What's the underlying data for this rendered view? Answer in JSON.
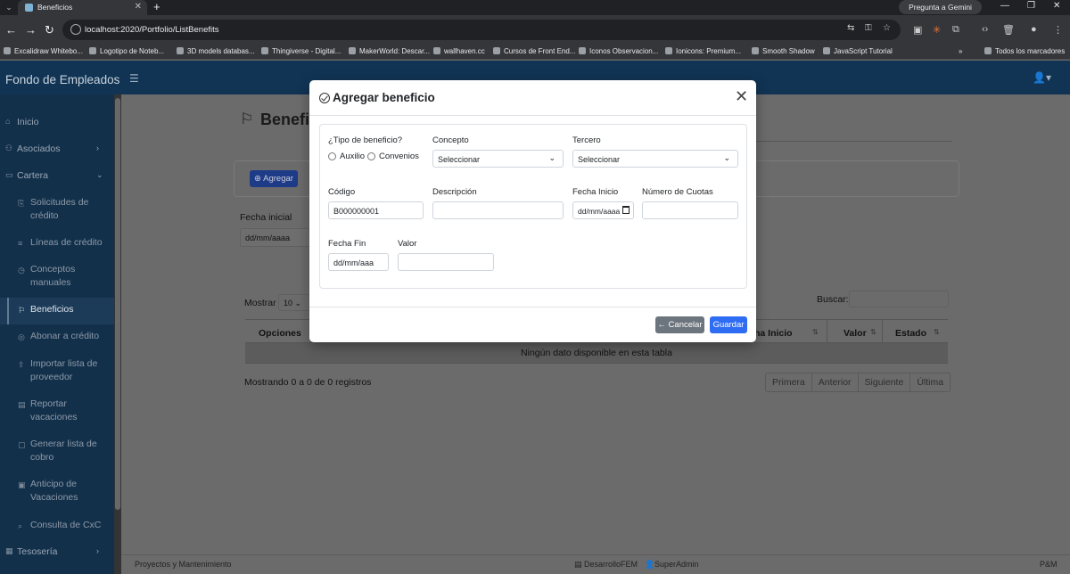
{
  "browser": {
    "tab_title": "Beneficios",
    "gemini_label": "Pregunta a Gemini",
    "url": "localhost:2020/Portfolio/ListBenefits",
    "bookmarks": [
      "Excalidraw Whitebo...",
      "Logotipo de Noteb...",
      "3D models databas...",
      "Thingiverse - Digital...",
      "MakerWorld: Descar...",
      "wallhaven.cc",
      "Cursos de Front End...",
      "Iconos Observacion...",
      "Ionicons: Premium...",
      "Smooth Shadow",
      "JavaScript Tutorial"
    ],
    "all_bookmarks": "Todos los marcadores"
  },
  "app": {
    "brand": "Fondo de Empleados"
  },
  "sidebar": {
    "items": [
      {
        "label": "Inicio",
        "icon": "home-icon"
      },
      {
        "label": "Asociados",
        "icon": "users-icon"
      },
      {
        "label": "Cartera",
        "icon": "wallet-icon"
      }
    ],
    "sub_items": [
      {
        "label": "Solicitudes de crédito",
        "icon": "request-icon"
      },
      {
        "label": "Líneas de crédito",
        "icon": "list-icon"
      },
      {
        "label": "Conceptos manuales",
        "icon": "concept-icon"
      },
      {
        "label": "Beneficios",
        "icon": "flag-icon"
      },
      {
        "label": "Abonar a crédito",
        "icon": "payment-icon"
      },
      {
        "label": "Importar lista de proveedor",
        "icon": "import-icon"
      },
      {
        "label": "Reportar vacaciones",
        "icon": "report-icon"
      },
      {
        "label": "Generar lista de cobro",
        "icon": "generate-icon"
      },
      {
        "label": "Anticipo de Vacaciones",
        "icon": "advance-icon"
      },
      {
        "label": "Consulta de CxC",
        "icon": "search-icon"
      }
    ],
    "bottom_item": {
      "label": "Tesosería",
      "icon": "treasury-icon"
    }
  },
  "page": {
    "title": "Beneficios",
    "add_button": "Agregar",
    "fecha_inicial_label": "Fecha inicial",
    "fecha_inicial_placeholder": "dd/mm/aaaa",
    "mostrar_label": "Mostrar",
    "mostrar_value": "10",
    "buscar_label": "Buscar:",
    "columns": [
      "Opciones",
      "ha Inicio",
      "Valor",
      "Estado"
    ],
    "empty_message": "Ningún dato disponible en esta tabla",
    "info": "Mostrando 0 a 0 de 0 registros",
    "pagination": [
      "Primera",
      "Anterior",
      "Siguiente",
      "Última"
    ]
  },
  "footer": {
    "left": "Proyectos y Mantenimiento",
    "center": "DesarrolloFEM",
    "user": "SuperAdmin",
    "right": "P&M"
  },
  "modal": {
    "title": "Agregar beneficio",
    "tipo_label": "¿Tipo de beneficio?",
    "radio_auxilio": "Auxilio",
    "radio_convenios": "Convenios",
    "concepto_label": "Concepto",
    "concepto_value": "Seleccionar",
    "tercero_label": "Tercero",
    "tercero_value": "Seleccionar",
    "codigo_label": "Código",
    "codigo_value": "B000000001",
    "descripcion_label": "Descripción",
    "fecha_inicio_label": "Fecha Inicio",
    "fecha_inicio_placeholder": "dd/mm/aaaa",
    "cuotas_label": "Número de Cuotas",
    "fecha_fin_label": "Fecha Fin",
    "fecha_fin_placeholder": "dd/mm/aaa",
    "valor_label": "Valor",
    "cancel_label": "Cancelar",
    "save_label": "Guardar"
  },
  "colors": {
    "header": "#113454",
    "sidebar": "#13304b",
    "primary": "#2f6cf4",
    "secondary": "#6c757d"
  }
}
